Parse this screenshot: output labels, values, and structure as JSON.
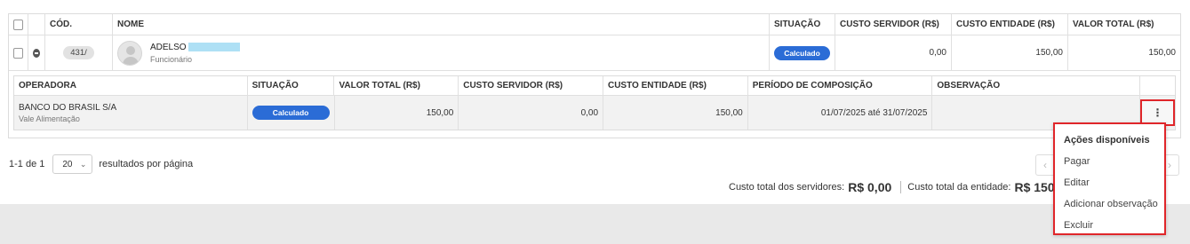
{
  "headers": {
    "cod": "CÓD.",
    "nome": "NOME",
    "situacao": "SITUAÇÃO",
    "custo_servidor": "CUSTO SERVIDOR (R$)",
    "custo_entidade": "CUSTO ENTIDADE (R$)",
    "valor_total": "VALOR TOTAL (R$)"
  },
  "employee": {
    "code": "431/",
    "name": "ADELSO",
    "role": "Funcionário",
    "status": "Calculado",
    "custo_servidor": "0,00",
    "custo_entidade": "150,00",
    "valor_total": "150,00"
  },
  "sub_headers": {
    "operadora": "OPERADORA",
    "situacao": "SITUAÇÃO",
    "valor_total": "VALOR TOTAL (R$)",
    "custo_servidor": "CUSTO SERVIDOR (R$)",
    "custo_entidade": "CUSTO ENTIDADE (R$)",
    "periodo": "PERÍODO DE COMPOSIÇÃO",
    "observacao": "OBSERVAÇÃO"
  },
  "benefit": {
    "operadora": "BANCO DO BRASIL S/A",
    "tipo": "Vale Alimentação",
    "status": "Calculado",
    "valor_total": "150,00",
    "custo_servidor": "0,00",
    "custo_entidade": "150,00",
    "periodo": "01/07/2025 até 31/07/2025",
    "observacao": "",
    "menu_glyph": "⋮"
  },
  "pagination": {
    "range": "1-1 de 1",
    "per_page": "20",
    "per_page_label": "resultados por página",
    "prev": "‹",
    "next": "›"
  },
  "totals": {
    "servidores_label": "Custo total dos servidores:",
    "servidores_value": "R$ 0,00",
    "entidade_label": "Custo total da entidade:",
    "entidade_value": "R$ 150,00"
  },
  "menu": {
    "title": "Ações disponíveis",
    "items": [
      "Pagar",
      "Editar",
      "Adicionar observação",
      "Excluir"
    ]
  },
  "colors": {
    "accent": "#2b6cd6",
    "highlight": "#e0262a"
  }
}
